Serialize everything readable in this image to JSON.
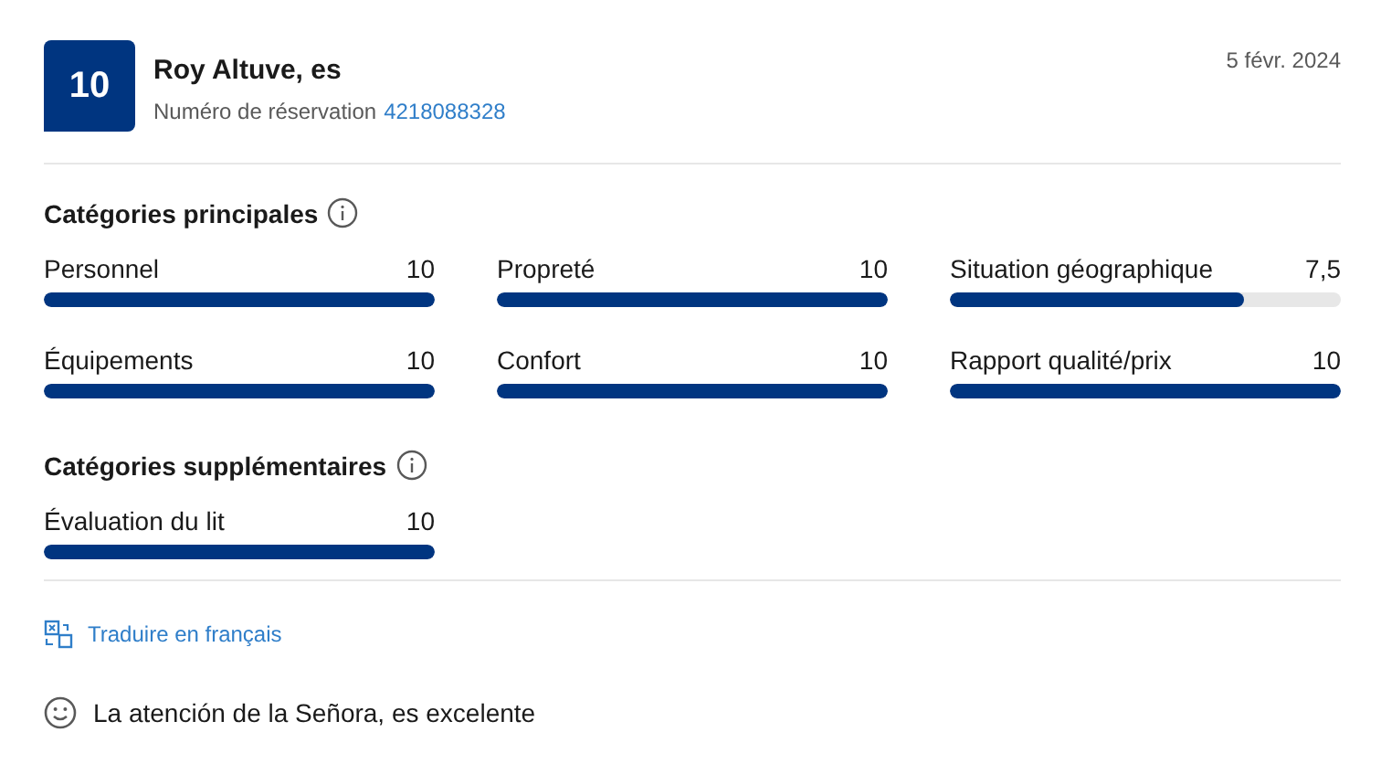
{
  "review": {
    "score": "10",
    "reviewer": "Roy Altuve, es",
    "reservation_label": "Numéro de réservation",
    "reservation_number": "4218088328",
    "date": "5 févr. 2024"
  },
  "sections": [
    {
      "title": "Catégories principales",
      "categories": [
        {
          "label": "Personnel",
          "value": "10",
          "level": 1
        },
        {
          "label": "Propreté",
          "value": "10",
          "level": 1
        },
        {
          "label": "Situation géographique",
          "value": "7,5",
          "level": 0.75
        },
        {
          "label": "Équipements",
          "value": "10",
          "level": 1
        },
        {
          "label": "Confort",
          "value": "10",
          "level": 1
        },
        {
          "label": "Rapport qualité/prix",
          "value": "10",
          "level": 1
        }
      ]
    },
    {
      "title": "Catégories supplémentaires",
      "categories": [
        {
          "label": "Évaluation du lit",
          "value": "10",
          "level": 1
        }
      ]
    }
  ],
  "translate_link": "Traduire en français",
  "comment": {
    "kind": "positive",
    "text": "La atención de la Señora, es excelente"
  }
}
